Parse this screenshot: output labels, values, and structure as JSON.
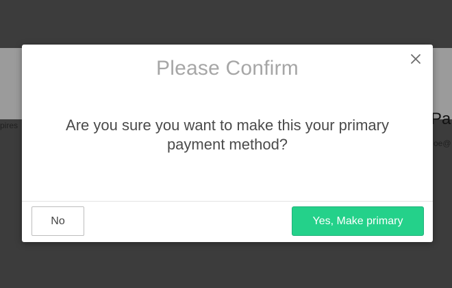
{
  "background": {
    "left_fragment": "pires",
    "right_title_fragment": "Pa",
    "right_subtext_fragment": "oe@"
  },
  "modal": {
    "title": "Please Confirm",
    "message": "Are you sure you want to make this your primary payment method?",
    "close_icon": "close-icon",
    "buttons": {
      "cancel_label": "No",
      "confirm_label": "Yes, Make primary"
    }
  },
  "colors": {
    "confirm_button_bg": "#24d18a",
    "confirm_button_text": "#ffffff",
    "title_text": "#a6a6a6",
    "body_text": "#4a4a4a",
    "page_dim": "#3c3c3c"
  }
}
